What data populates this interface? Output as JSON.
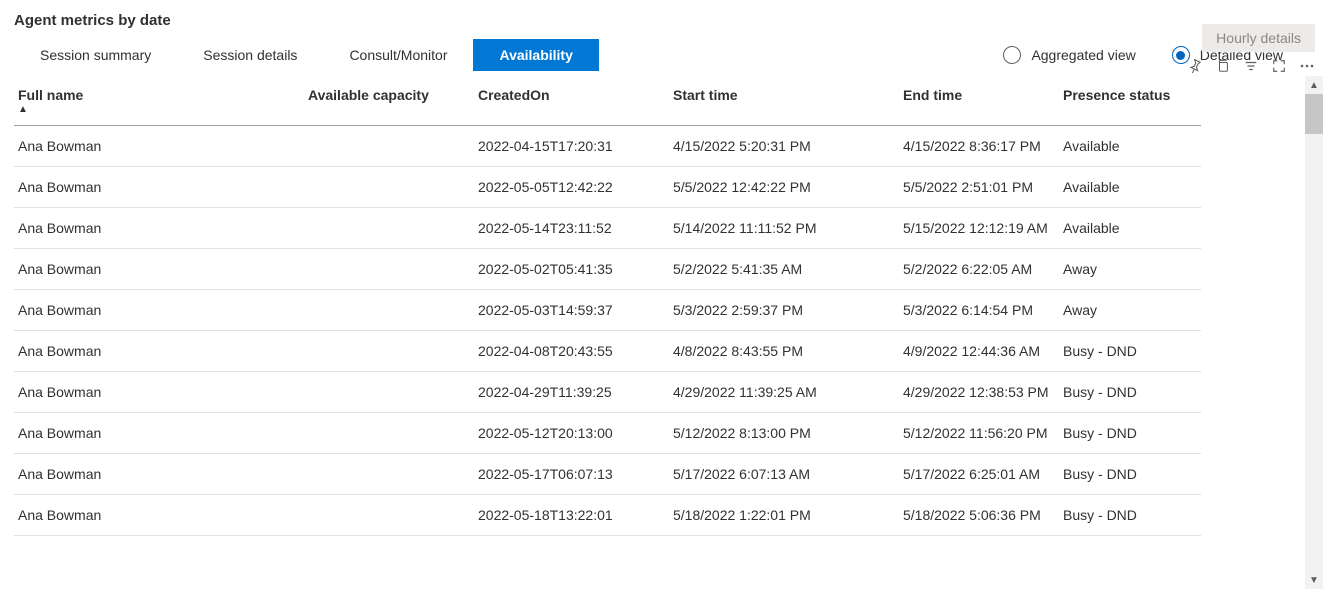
{
  "title": "Agent metrics by date",
  "tabs": [
    {
      "label": "Session summary",
      "active": false
    },
    {
      "label": "Session details",
      "active": false
    },
    {
      "label": "Consult/Monitor",
      "active": false
    },
    {
      "label": "Availability",
      "active": true
    }
  ],
  "view": {
    "aggregated_label": "Aggregated view",
    "detailed_label": "Detailed view",
    "selected": "detailed"
  },
  "hourly_button": "Hourly details",
  "icons": {
    "pin": "pin-icon",
    "copy": "copy-icon",
    "filter": "filter-icon",
    "focus": "focus-mode-icon",
    "more": "more-options-icon"
  },
  "columns": [
    {
      "key": "name",
      "label": "Full name",
      "sorted_asc": true
    },
    {
      "key": "cap",
      "label": "Available capacity"
    },
    {
      "key": "created",
      "label": "CreatedOn"
    },
    {
      "key": "start",
      "label": "Start time"
    },
    {
      "key": "end",
      "label": "End time"
    },
    {
      "key": "status",
      "label": "Presence status"
    }
  ],
  "rows": [
    {
      "name": "Ana Bowman",
      "cap": "",
      "created": "2022-04-15T17:20:31",
      "start": "4/15/2022 5:20:31 PM",
      "end": "4/15/2022 8:36:17 PM",
      "status": "Available"
    },
    {
      "name": "Ana Bowman",
      "cap": "",
      "created": "2022-05-05T12:42:22",
      "start": "5/5/2022 12:42:22 PM",
      "end": "5/5/2022 2:51:01 PM",
      "status": "Available"
    },
    {
      "name": "Ana Bowman",
      "cap": "",
      "created": "2022-05-14T23:11:52",
      "start": "5/14/2022 11:11:52 PM",
      "end": "5/15/2022 12:12:19 AM",
      "status": "Available"
    },
    {
      "name": "Ana Bowman",
      "cap": "",
      "created": "2022-05-02T05:41:35",
      "start": "5/2/2022 5:41:35 AM",
      "end": "5/2/2022 6:22:05 AM",
      "status": "Away"
    },
    {
      "name": "Ana Bowman",
      "cap": "",
      "created": "2022-05-03T14:59:37",
      "start": "5/3/2022 2:59:37 PM",
      "end": "5/3/2022 6:14:54 PM",
      "status": "Away"
    },
    {
      "name": "Ana Bowman",
      "cap": "",
      "created": "2022-04-08T20:43:55",
      "start": "4/8/2022 8:43:55 PM",
      "end": "4/9/2022 12:44:36 AM",
      "status": "Busy - DND"
    },
    {
      "name": "Ana Bowman",
      "cap": "",
      "created": "2022-04-29T11:39:25",
      "start": "4/29/2022 11:39:25 AM",
      "end": "4/29/2022 12:38:53 PM",
      "status": "Busy - DND"
    },
    {
      "name": "Ana Bowman",
      "cap": "",
      "created": "2022-05-12T20:13:00",
      "start": "5/12/2022 8:13:00 PM",
      "end": "5/12/2022 11:56:20 PM",
      "status": "Busy - DND"
    },
    {
      "name": "Ana Bowman",
      "cap": "",
      "created": "2022-05-17T06:07:13",
      "start": "5/17/2022 6:07:13 AM",
      "end": "5/17/2022 6:25:01 AM",
      "status": "Busy - DND"
    },
    {
      "name": "Ana Bowman",
      "cap": "",
      "created": "2022-05-18T13:22:01",
      "start": "5/18/2022 1:22:01 PM",
      "end": "5/18/2022 5:06:36 PM",
      "status": "Busy - DND"
    }
  ]
}
